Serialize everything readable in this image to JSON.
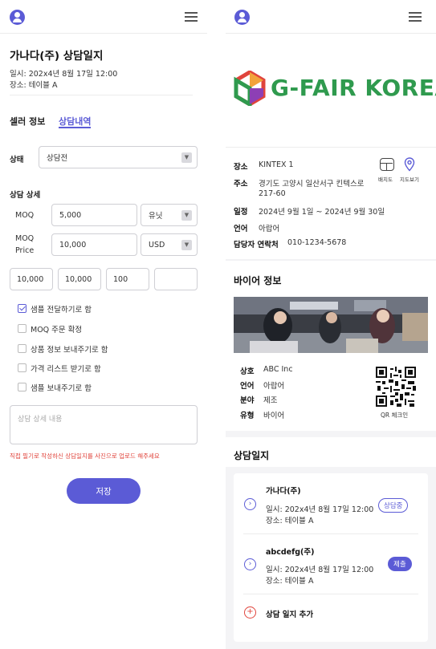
{
  "left": {
    "record_title": "가나다(주) 상담일지",
    "datetime": "일시: 202x4년 8월 17일 12:00",
    "place": "장소: 테이블 A",
    "tabs": [
      "셀러 정보",
      "상담내역"
    ],
    "active_tab": "상담내역",
    "status_label": "상태",
    "status_value": "상담전",
    "detail_label": "상담 상세",
    "moq_label": "MOQ",
    "moq_value": "5,000",
    "moq_unit": "유닛",
    "moq_price_label_1": "MOQ",
    "moq_price_label_2": "Price",
    "moq_price_value": "10,000",
    "moq_price_currency": "USD",
    "extra_values": [
      "10,000",
      "10,000",
      "100",
      ""
    ],
    "checkboxes": [
      {
        "label": "샘플 전달하기로 함",
        "checked": true
      },
      {
        "label": "MOQ 주문 확정",
        "checked": false
      },
      {
        "label": "상품 정보 보내주기로 함",
        "checked": false
      },
      {
        "label": "가격 리스트 받기로 함",
        "checked": false
      },
      {
        "label": "샘플 보내주기로 함",
        "checked": false
      }
    ],
    "detail_placeholder": "상담 상세 내용",
    "notice": "직접 필기로 작성하신 상담일지를 사진으로 업로드 해주세요",
    "save_label": "저장"
  },
  "right": {
    "logo_text": "G-FAIR KOREA",
    "venue": {
      "place_k": "장소",
      "place_v": "KINTEX 1",
      "addr_k": "주소",
      "addr_v1": "경기도 고양시 일산서구 킨텍스로",
      "addr_v2": "217-60",
      "date_k": "일정",
      "date_v": "2024년 9월 1일 ~ 2024년 9월 30일",
      "lang_k": "언어",
      "lang_v": "아랍어",
      "contact_k": "담당자 연락처",
      "contact_v": "010-1234-5678",
      "layout_label": "배치도",
      "map_label": "지도보기"
    },
    "buyer_title": "바이어 정보",
    "buyer": {
      "name_k": "상호",
      "name_v": "ABC Inc",
      "lang_k": "언어",
      "lang_v": "아랍어",
      "field_k": "분야",
      "field_v": "제조",
      "type_k": "유형",
      "type_v": "바이어",
      "qr_label": "QR 체크인"
    },
    "log_title": "상담일지",
    "logs": [
      {
        "name": "가나다(주)",
        "datetime": "일시: 202x4년 8월 17일 12:00",
        "place": "장소: 테이블 A",
        "badge": "상담중"
      },
      {
        "name": "abcdefg(주)",
        "datetime": "일시: 202x4년 8월 17일 12:00",
        "place": "장소: 테이블 A",
        "badge": "제출"
      }
    ],
    "add_label": "상담 일지 추가"
  },
  "colors": {
    "accent": "#5b5bd6",
    "logo_green": "#2f9a4e",
    "notice_red": "#e0443c"
  },
  "icons": [
    "user-icon",
    "hamburger-menu-icon",
    "chevron-down-icon",
    "check-icon",
    "layout-icon",
    "map-pin-icon",
    "qr-code-icon",
    "chevron-right-icon",
    "plus-icon"
  ]
}
